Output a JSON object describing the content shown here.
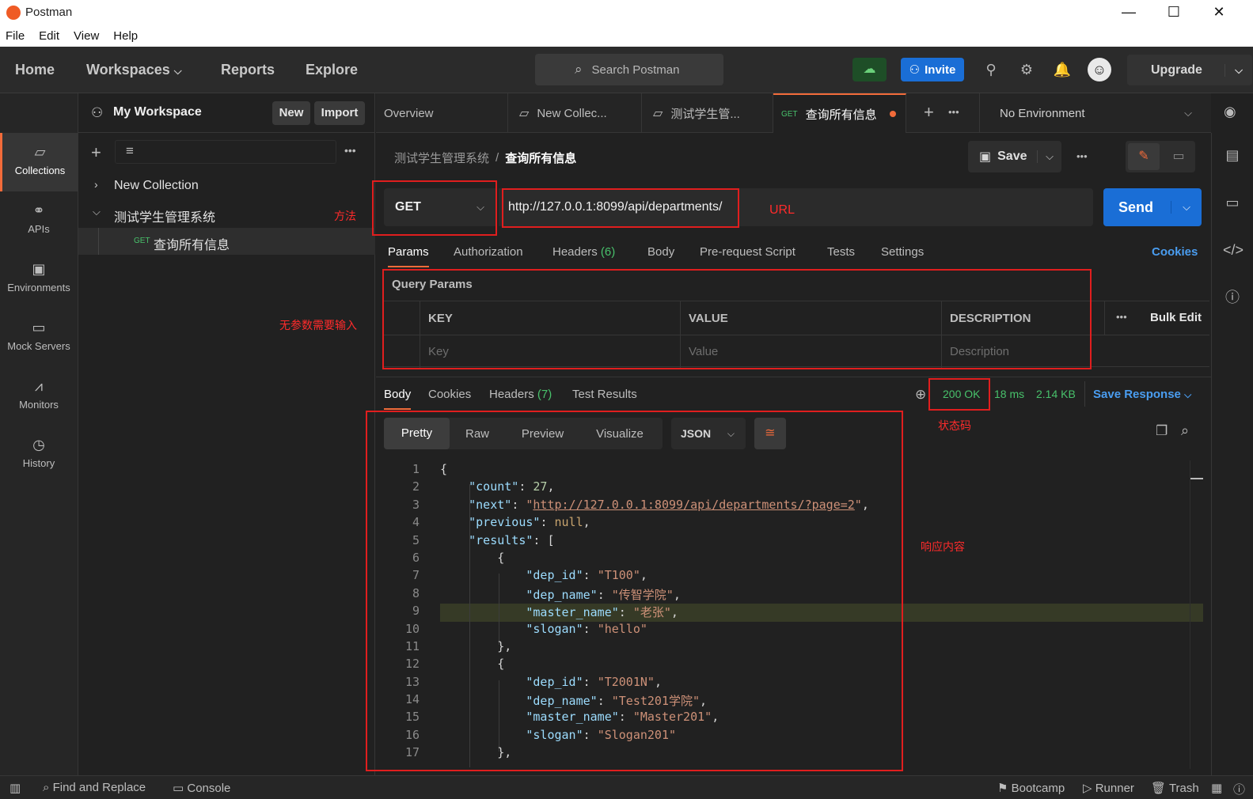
{
  "window": {
    "title": "Postman",
    "minimize": "—",
    "maximize": "☐",
    "close": "✕"
  },
  "menu": [
    "File",
    "Edit",
    "View",
    "Help"
  ],
  "header": {
    "nav": [
      "Home",
      "Workspaces",
      "Reports",
      "Explore"
    ],
    "search_placeholder": "Search Postman",
    "invite_label": "Invite",
    "upgrade_label": "Upgrade"
  },
  "rail": [
    {
      "label": "Collections",
      "icon": "collections-icon"
    },
    {
      "label": "APIs",
      "icon": "apis-icon"
    },
    {
      "label": "Environments",
      "icon": "environments-icon"
    },
    {
      "label": "Mock Servers",
      "icon": "mock-servers-icon"
    },
    {
      "label": "Monitors",
      "icon": "monitors-icon"
    },
    {
      "label": "History",
      "icon": "history-icon"
    }
  ],
  "sidebar": {
    "workspace": "My Workspace",
    "new_label": "New",
    "import_label": "Import",
    "tree": [
      {
        "label": "New Collection"
      },
      {
        "label": "测试学生管理系统"
      },
      {
        "method": "GET",
        "label": "查询所有信息"
      }
    ]
  },
  "tabs": [
    {
      "label": "Overview"
    },
    {
      "label": "New Collec..."
    },
    {
      "label": "测试学生管..."
    },
    {
      "method": "GET",
      "label": "查询所有信息"
    }
  ],
  "environment": "No Environment",
  "request": {
    "breadcrumb_parent": "测试学生管理系统",
    "breadcrumb_sep": "/",
    "breadcrumb_current": "查询所有信息",
    "save_label": "Save",
    "method": "GET",
    "url": "http://127.0.0.1:8099/api/departments/",
    "send_label": "Send",
    "tabs": [
      "Params",
      "Authorization",
      "Headers",
      "Body",
      "Pre-request Script",
      "Tests",
      "Settings"
    ],
    "headers_count": "(6)",
    "cookies_label": "Cookies",
    "query_params_title": "Query Params",
    "columns": [
      "KEY",
      "VALUE",
      "DESCRIPTION"
    ],
    "placeholders": [
      "Key",
      "Value",
      "Description"
    ],
    "bulk_edit": "Bulk Edit"
  },
  "response": {
    "tabs": [
      "Body",
      "Cookies",
      "Headers",
      "Test Results"
    ],
    "headers_count": "(7)",
    "status": "200 OK",
    "time": "18 ms",
    "size": "2.14 KB",
    "save_response": "Save Response",
    "views": [
      "Pretty",
      "Raw",
      "Preview",
      "Visualize"
    ],
    "format": "JSON"
  },
  "annotations": {
    "method": "方法",
    "url": "URL",
    "params": "无参数需要输入",
    "status": "状态码",
    "body": "响应内容"
  },
  "code": {
    "line_numbers": [
      "1",
      "2",
      "3",
      "4",
      "5",
      "6",
      "7",
      "8",
      "9",
      "10",
      "11",
      "12",
      "13",
      "14",
      "15",
      "16",
      "17"
    ],
    "count": "27",
    "next_url": "http://127.0.0.1:8099/api/departments/?page=2",
    "previous": "null",
    "results": [
      {
        "dep_id": "T100",
        "dep_name": "传智学院",
        "master_name": "老张",
        "slogan": "hello"
      },
      {
        "dep_id": "T2001N",
        "dep_name": "Test201学院",
        "master_name": "Master201",
        "slogan": "Slogan201"
      }
    ]
  },
  "statusbar": {
    "find": "Find and Replace",
    "console": "Console",
    "bootcamp": "Bootcamp",
    "runner": "Runner",
    "trash": "Trash"
  }
}
